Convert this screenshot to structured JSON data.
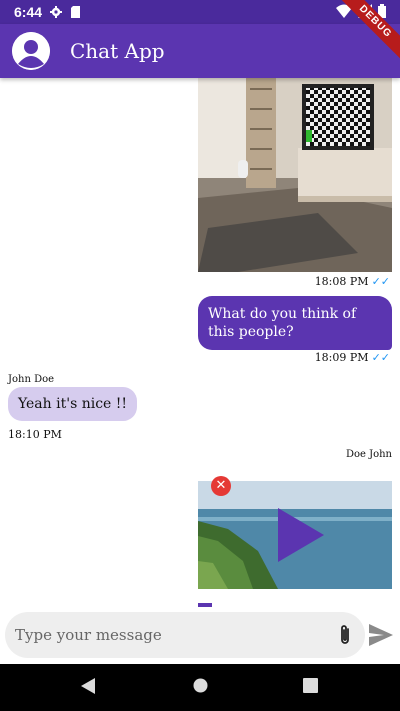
{
  "status_bar": {
    "time": "6:44",
    "debug_label": "DEBUG"
  },
  "app_bar": {
    "title": "Chat App"
  },
  "messages": [
    {
      "type": "image",
      "time": "18:08 PM",
      "read": true
    },
    {
      "type": "text",
      "direction": "out",
      "text": "What do you think of this people?",
      "time": "18:09 PM",
      "read": true
    },
    {
      "type": "text",
      "direction": "in",
      "sender": "John Doe",
      "text": "Yeah it's nice !!",
      "time": "18:10 PM"
    },
    {
      "type": "video",
      "direction": "out",
      "sender": "Doe John"
    }
  ],
  "composer": {
    "placeholder": "Type your message"
  },
  "colors": {
    "primary": "#5b35b0",
    "status_bar": "#4a2a9c",
    "incoming_bubble": "#d6ccee",
    "read_check": "#2196f3",
    "delete": "#e53935"
  },
  "icons": [
    "settings-icon",
    "sd-card-icon",
    "wifi-icon",
    "signal-icon",
    "battery-icon",
    "avatar-icon",
    "check-icon",
    "close-icon",
    "play-icon",
    "attach-icon",
    "send-icon",
    "nav-back-icon",
    "nav-home-icon",
    "nav-recents-icon"
  ]
}
